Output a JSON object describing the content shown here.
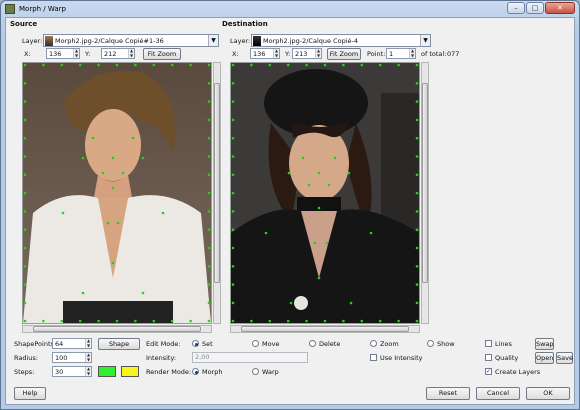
{
  "window": {
    "title": "Morph / Warp",
    "controls": {
      "minimize": "–",
      "maximize": "□",
      "close": "✕"
    }
  },
  "source": {
    "heading": "Source",
    "layer_label": "Layer:",
    "layer_value": "Morph2.jpg-2/Calque Copié#1-36",
    "x_label": "X:",
    "x_value": "136",
    "y_label": "Y:",
    "y_value": "212",
    "fit_zoom": "Fit Zoom"
  },
  "destination": {
    "heading": "Destination",
    "layer_label": "Layer:",
    "layer_value": "Morph2.jpg-2/Calque Copié-4",
    "x_label": "X:",
    "x_value": "136",
    "y_label": "Y:",
    "y_value": "213",
    "fit_zoom": "Fit Zoom",
    "point_label": "Point:",
    "point_value": "1",
    "of_total_label": "of total:",
    "total_value": "077"
  },
  "options": {
    "shapepoints_label": "ShapePoints:",
    "shapepoints_value": "64",
    "shape_button": "Shape",
    "radius_label": "Radius:",
    "radius_value": "100",
    "steps_label": "Steps:",
    "steps_value": "30",
    "color_a": "#2ef02e",
    "color_b": "#f6f61e",
    "edit_mode_label": "Edit Mode:",
    "edit_modes": [
      "Set",
      "Move",
      "Delete",
      "Zoom",
      "Show"
    ],
    "edit_mode_selected": "Set",
    "intensity_label": "Intensity:",
    "intensity_value": "2,00",
    "use_intensity": "Use Intensity",
    "render_mode_label": "Render Mode:",
    "render_modes": [
      "Morph",
      "Warp"
    ],
    "render_mode_selected": "Morph",
    "lines": "Lines",
    "quality": "Quality",
    "create_layers": "Create Layers",
    "create_layers_checked": true,
    "swap": "Swap",
    "open": "Open",
    "save": "Save"
  },
  "footer": {
    "help": "Help",
    "reset": "Reset",
    "cancel": "Cancel",
    "ok": "OK"
  },
  "colors": {
    "point_marker": "#1dd41d",
    "accent": "#1f3a66"
  }
}
